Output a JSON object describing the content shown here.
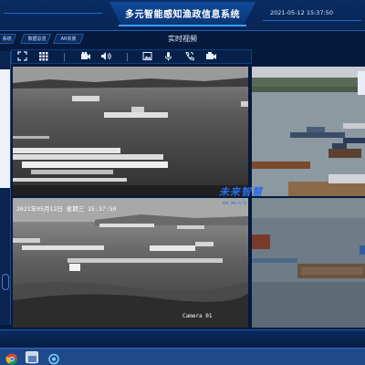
{
  "header": {
    "title": "多元智能感知渔政信息系统",
    "datetime": "2021-05-12 15:37:50"
  },
  "tabs": [
    {
      "label": "系统"
    },
    {
      "label": "数据总览"
    },
    {
      "label": "AR实景"
    }
  ],
  "section_title": "实时视频",
  "toolbar": {
    "icons": [
      "fullscreen-icon",
      "grid-icon",
      "camera-icon",
      "volume-icon",
      "image-icon",
      "microphone-icon",
      "phone-icon",
      "record-icon"
    ]
  },
  "cameras": {
    "cam2_osd": "2021年05月12日 星期三 15:37:50",
    "cam2_label": "Camera 01"
  },
  "watermark": {
    "text": "未来智慧",
    "sub": "Wei Wei Xi Tu"
  },
  "colors": {
    "accent": "#37a0ff",
    "header_bg": "#0a2d63",
    "taskbar": "#1e4a8c"
  }
}
